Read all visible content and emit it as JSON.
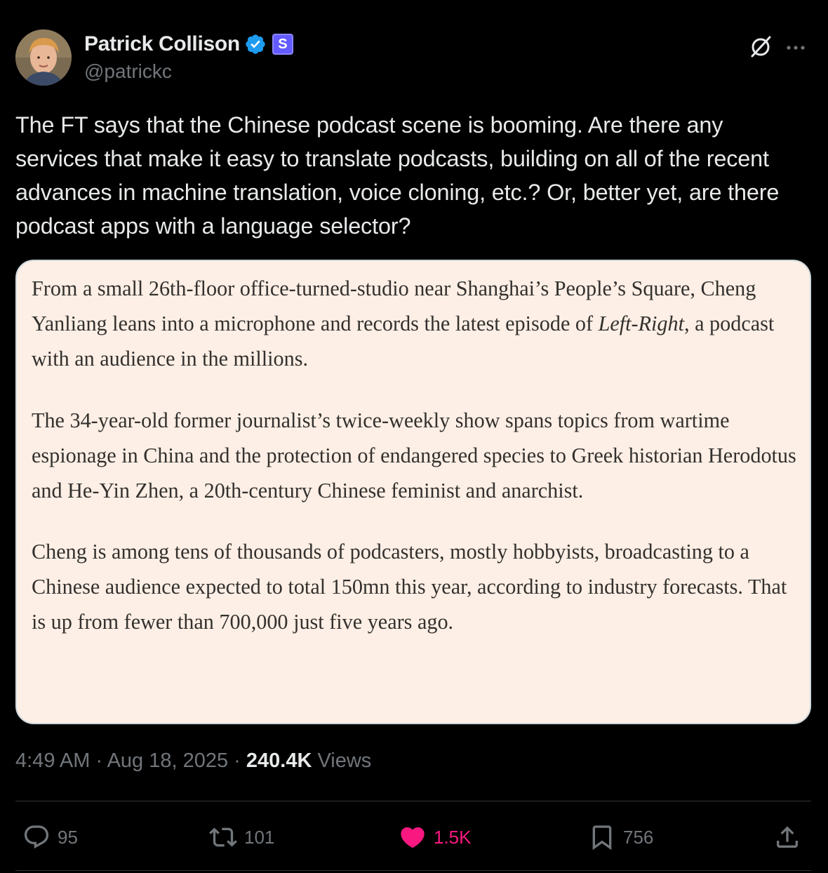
{
  "author": {
    "name": "Patrick Collison",
    "handle": "@patrickc",
    "subscription_badge": "S",
    "verified_icon": "verified-badge-icon"
  },
  "tweet": {
    "text": "The FT says that the Chinese podcast scene is booming. Are there any services that make it easy to translate podcasts, building on all of the recent advances in machine translation, voice cloning, etc.? Or, better yet, are there podcast apps with a language selector?"
  },
  "quote": {
    "p1_before": "From a small 26th-floor office-turned-studio near Shanghai’s People’s Square, Cheng Yanliang leans into a microphone and records the latest episode of ",
    "p1_italic": "Left-Right",
    "p1_after": ", a podcast with an audience in the millions.",
    "p2": "The 34-year-old former journalist’s twice-weekly show spans topics from wartime espionage in China and the protection of endangered species to Greek historian Herodotus and He-Yin Zhen, a 20th-century Chinese feminist and anarchist.",
    "p3": "Cheng is among tens of thousands of podcasters, mostly hobbyists, broadcasting to a Chinese audience expected to total 150mn this year, according to industry forecasts. That is up from fewer than 700,000 just five years ago."
  },
  "meta": {
    "time": "4:49 AM",
    "separator": " · ",
    "date": "Aug 18, 2025",
    "views_count": "240.4K",
    "views_label": " Views"
  },
  "actions": {
    "replies": "95",
    "retweets": "101",
    "likes": "1.5K",
    "bookmarks": "756"
  },
  "colors": {
    "background": "#000000",
    "text": "#e7e9ea",
    "muted": "#71767b",
    "verified": "#1d9bf0",
    "like": "#f91880",
    "quote_bg": "#fdefe5",
    "subscription_badge": "#635bff"
  }
}
